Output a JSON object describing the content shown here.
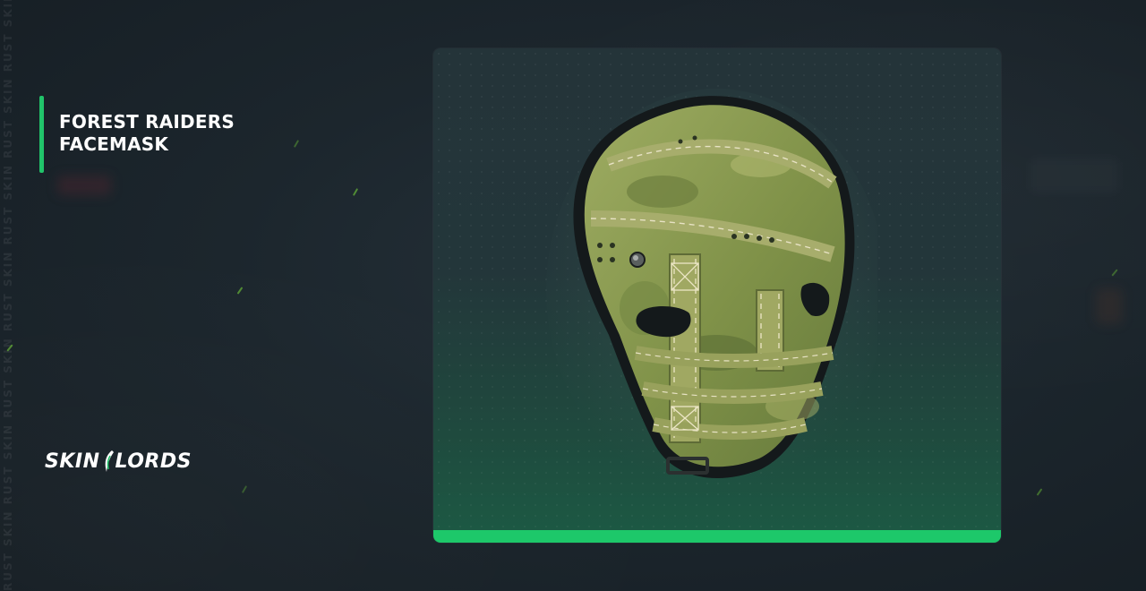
{
  "item": {
    "title_line1": "FOREST RAIDERS",
    "title_line2": "FACEMASK"
  },
  "brand": {
    "logo_left": "SKIN",
    "logo_right": "LORDS"
  },
  "watermark": {
    "text": "RUST SKIN RUST SKIN RUST SKIN RUST SKIN RUST SKIN RUST SKIN RUST SKIN RUST SKIN"
  },
  "colors": {
    "accent": "#1dc86a",
    "background": "#1c262d",
    "card_top": "#243439",
    "card_bottom": "#1c5a44",
    "mask_camo": "#8a9a4e"
  },
  "icons": {
    "logo_mark": "leaf-slash-icon",
    "item_image": "facemask-icon"
  }
}
